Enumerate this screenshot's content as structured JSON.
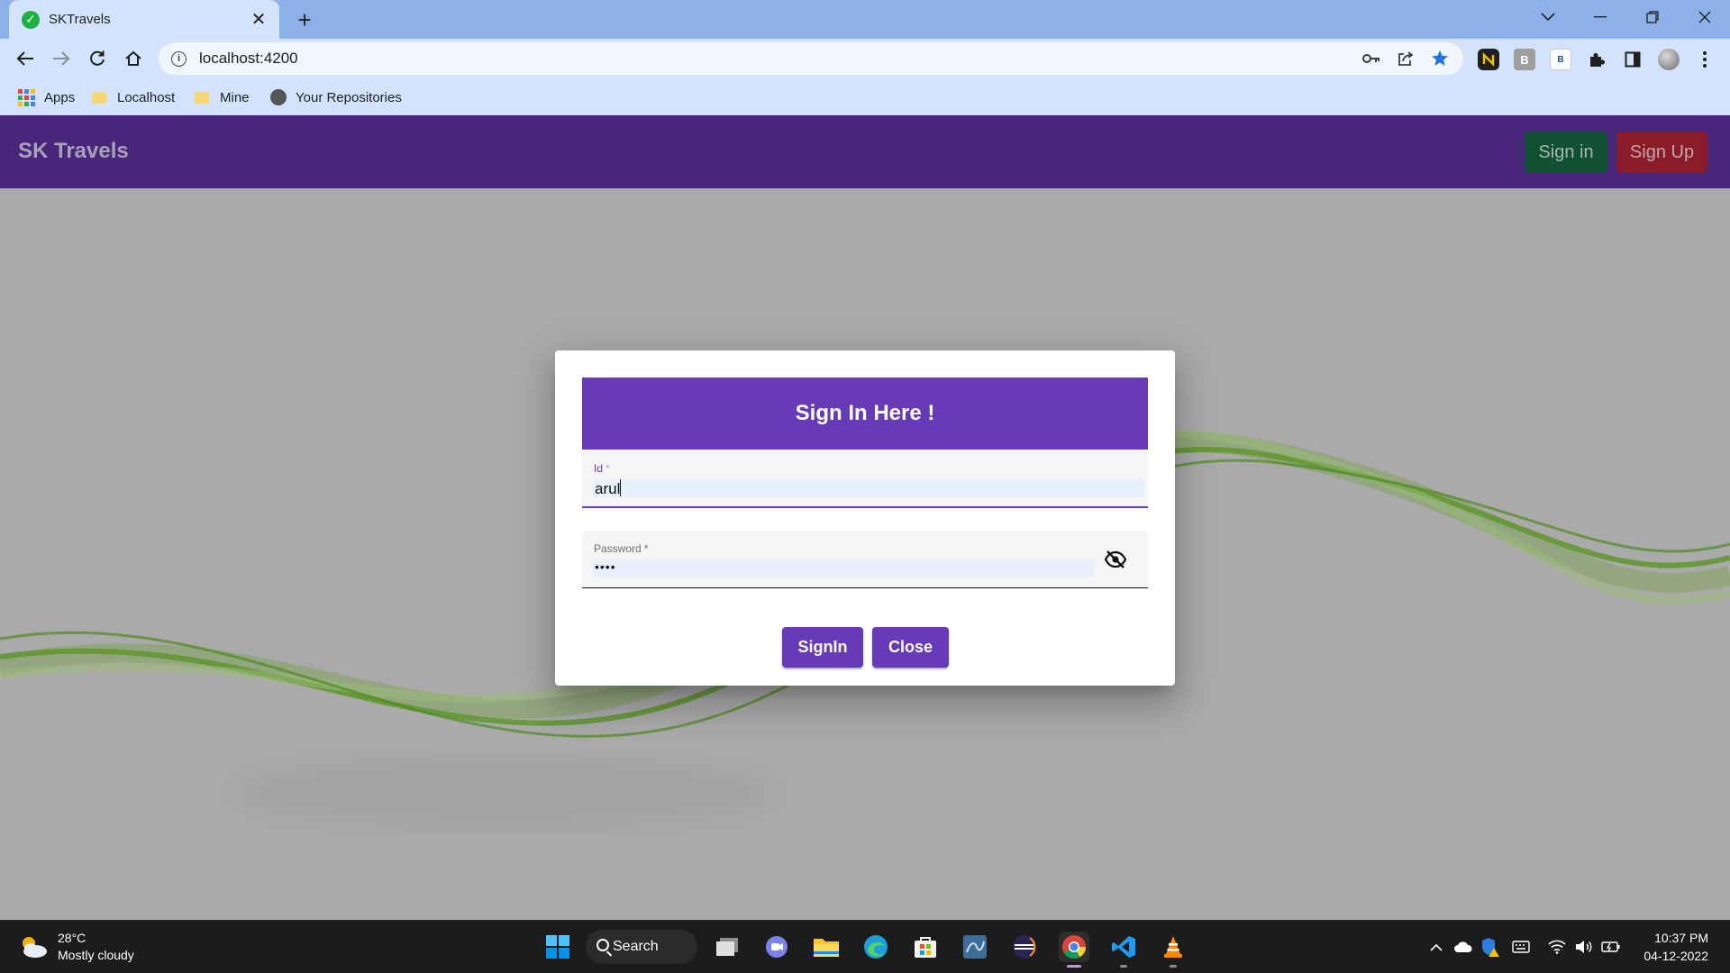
{
  "browser": {
    "tab": {
      "title": "SKTravels",
      "close": "✕"
    },
    "new_tab": "+",
    "url": "localhost:4200",
    "bookmarks": [
      {
        "label": "Apps"
      },
      {
        "label": "Localhost"
      },
      {
        "label": "Mine"
      },
      {
        "label": "Your Repositories"
      }
    ],
    "extension_labels": {
      "b1": "B",
      "b2": "B"
    }
  },
  "app": {
    "brand": "SK Travels",
    "header_buttons": {
      "signin": "Sign in",
      "signup": "Sign Up"
    },
    "colors": {
      "navbar": "#48267a",
      "primary": "#673ab7",
      "signin_btn": "#0f5132",
      "signup_btn": "#8a1c2a"
    }
  },
  "dialog": {
    "title": "Sign In Here !",
    "id_field": {
      "label": "Id",
      "required_mark": "*",
      "value": "arul"
    },
    "password_field": {
      "label": "Password",
      "required_mark": "*",
      "masked_value": "••••"
    },
    "buttons": {
      "signin": "SignIn",
      "close": "Close"
    }
  },
  "taskbar": {
    "weather": {
      "temp": "28°C",
      "condition": "Mostly cloudy"
    },
    "search_label": "Search",
    "pinned": [
      "start-icon",
      "task-view-icon",
      "teams-chat-icon",
      "file-explorer-icon",
      "edge-icon",
      "store-icon",
      "mysql-workbench-icon",
      "eclipse-icon",
      "chrome-icon",
      "vscode-icon",
      "vlc-icon"
    ],
    "time": "10:37 PM",
    "date": "04-12-2022"
  }
}
